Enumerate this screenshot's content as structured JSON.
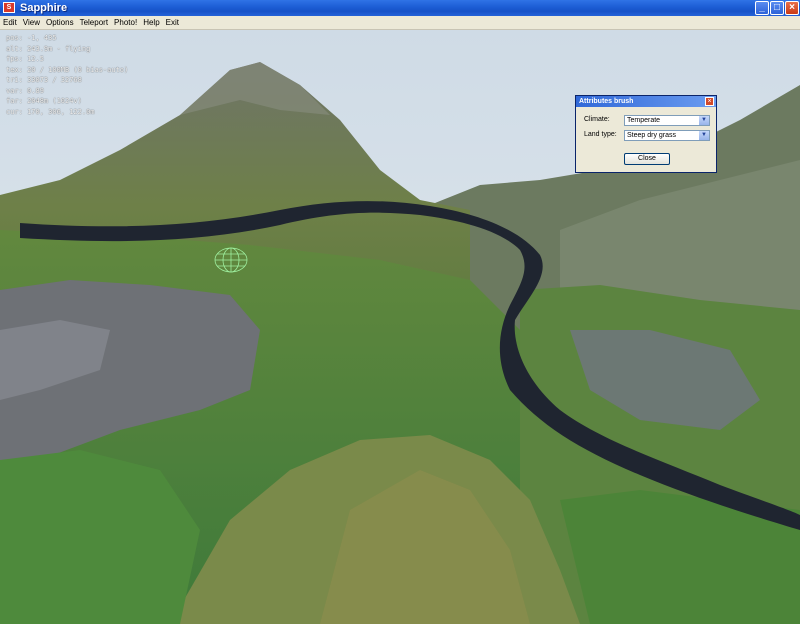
{
  "window": {
    "title": "Sapphire",
    "icon": "app-icon",
    "minimize": "_",
    "maximize": "□",
    "close": "×"
  },
  "menu": [
    "Edit",
    "View",
    "Options",
    "Teleport",
    "Photo!",
    "Help",
    "Exit"
  ],
  "hud": [
    "pos: -1, 435",
    "alt: 243.9m - flying",
    "fps: 12.5",
    "tex: 20 / 100MB (0 bias-auto)",
    "tri: 33073 / 32768",
    "var: 0.89",
    "far: 2048m (1024v)",
    "cur: 170, 306, 122.0m"
  ],
  "dialog": {
    "title": "Attributes brush",
    "climate_label": "Climate:",
    "climate_value": "Temperate",
    "landtype_label": "Land type:",
    "landtype_value": "Steep dry grass",
    "close_button": "Close"
  },
  "colors": {
    "titlebar": "#1e5fd6",
    "menubar": "#ece9d8",
    "river": "#1f2530",
    "grass": "#5a8a3a",
    "rock": "#7a7a80",
    "sky": "#d8e4ee"
  }
}
